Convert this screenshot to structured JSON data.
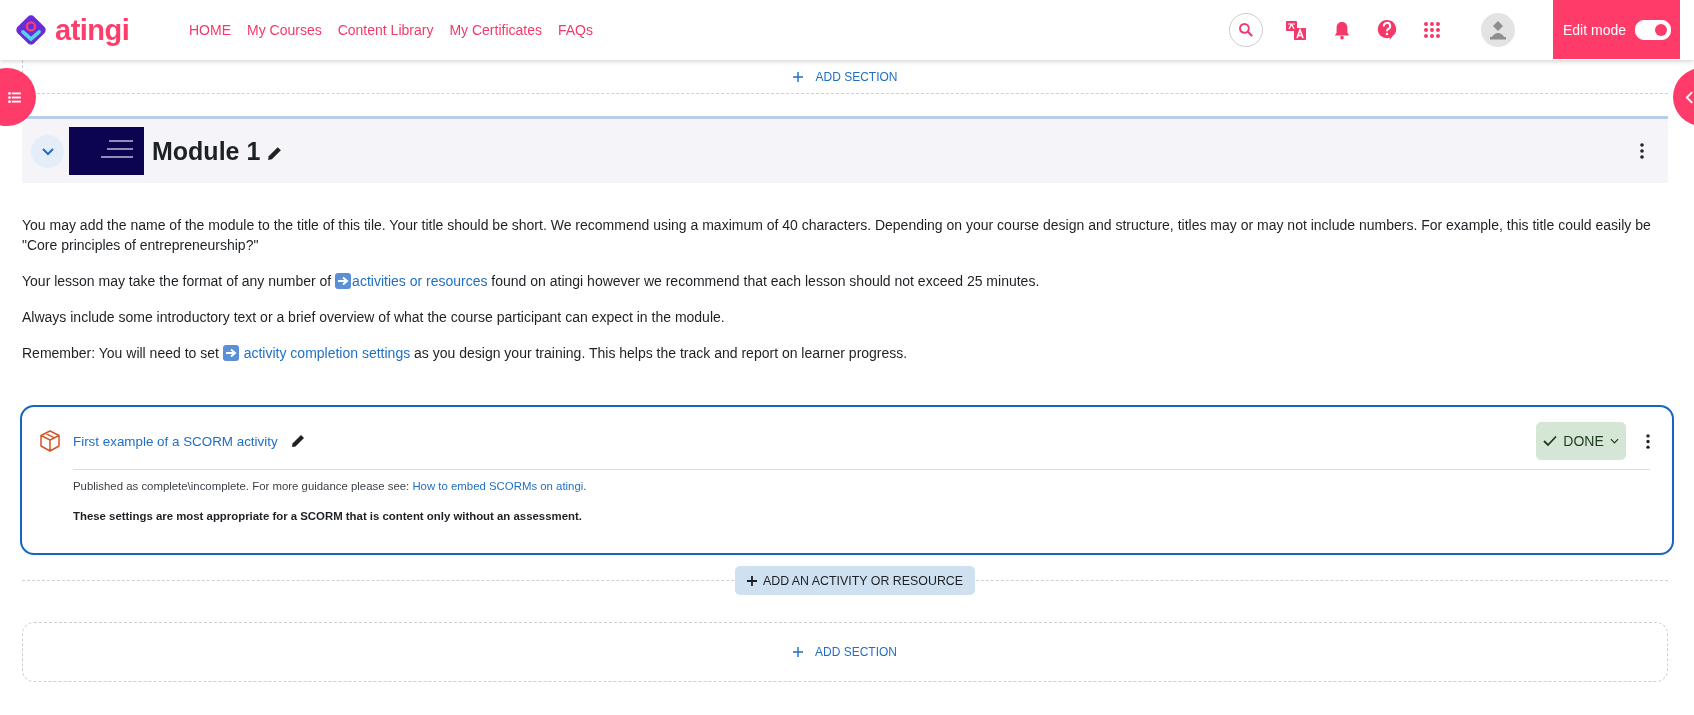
{
  "header": {
    "logo": "atingi",
    "nav": [
      {
        "label": "HOME"
      },
      {
        "label": "My Courses"
      },
      {
        "label": "Content Library"
      },
      {
        "label": "My Certificates"
      },
      {
        "label": "FAQs"
      }
    ],
    "edit_mode": {
      "label": "Edit mode",
      "on": true
    }
  },
  "top_add_section": "ADD SECTION",
  "module": {
    "title": "Module 1",
    "expanded": true,
    "paragraphs": [
      [
        {
          "kind": "text",
          "text": "You may add the name of the module to the title of this tile.  Your title should be short.  We recommend using a maximum of 40 characters. Depending on your course design and structure, titles may or may not include numbers. For example, this title could easily be \"Core principles of entrepreneurship?\""
        }
      ],
      [
        {
          "kind": "text",
          "text": "Your lesson may take the format of any number of "
        },
        {
          "kind": "arrow-link",
          "text": "activities or resources"
        },
        {
          "kind": "text",
          "text": " found on atingi however we recommend that each lesson should not exceed 25 minutes."
        }
      ],
      [
        {
          "kind": "text",
          "text": "Always include some introductory text or a brief overview of what the course participant can expect in the module."
        }
      ],
      [
        {
          "kind": "text",
          "text": "Remember: You will need to set "
        },
        {
          "kind": "arrow-link",
          "text": " activity completion settings"
        },
        {
          "kind": "text",
          "text": " as you design your training. This helps the track and report on learner progress."
        }
      ]
    ]
  },
  "activity": {
    "title": "First example of a SCORM activity",
    "completion": {
      "label": "DONE",
      "done": true
    },
    "description": [
      {
        "kind": "text",
        "text": "Published as complete\\incomplete. For more guidance please see: "
      },
      {
        "kind": "link",
        "text": "How to embed SCORMs on atingi"
      },
      {
        "kind": "text",
        "text": "."
      }
    ],
    "note": "These settings are most appropriate for a SCORM that is content only without an assessment."
  },
  "add_activity": "ADD AN ACTIVITY OR RESOURCE",
  "bottom_add_section": "ADD SECTION"
}
